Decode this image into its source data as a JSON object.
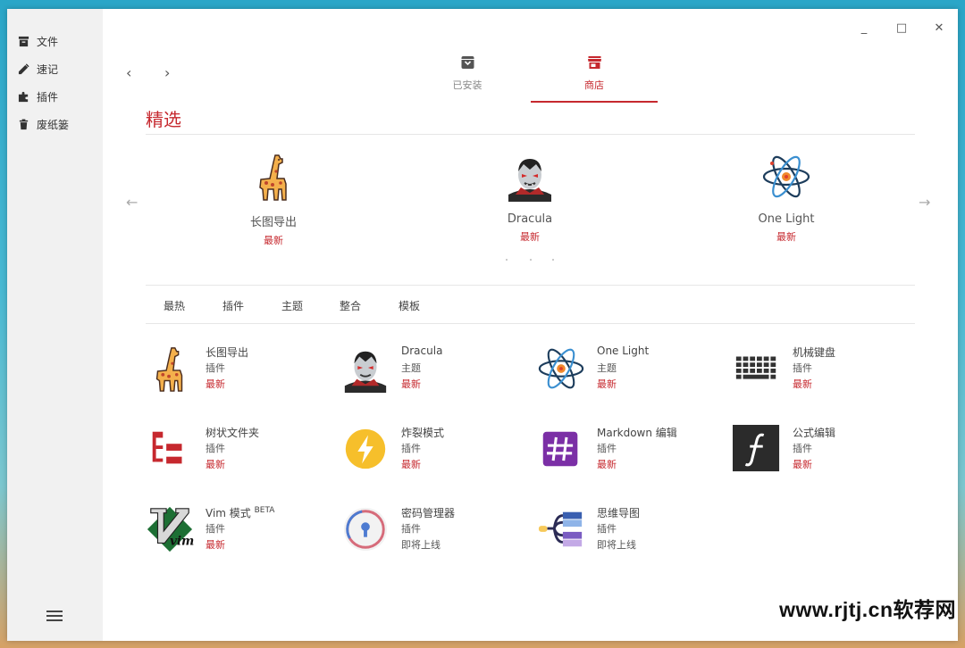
{
  "sidebar": {
    "items": [
      {
        "label": "文件",
        "icon": "archive-icon"
      },
      {
        "label": "速记",
        "icon": "pencil-icon"
      },
      {
        "label": "插件",
        "icon": "puzzle-icon"
      },
      {
        "label": "废纸篓",
        "icon": "trash-icon"
      }
    ],
    "menu_icon": "hamburger-icon"
  },
  "window_controls": {
    "minimize": "_",
    "maximize": "□",
    "close": "✕"
  },
  "nav": {
    "back": "‹",
    "forward": "›"
  },
  "tabs": [
    {
      "label": "已安装",
      "icon": "installed-box-icon",
      "active": false
    },
    {
      "label": "商店",
      "icon": "store-icon",
      "active": true
    }
  ],
  "featured": {
    "title": "精选",
    "prev": "←",
    "next": "→",
    "items": [
      {
        "name": "长图导出",
        "tag": "最新",
        "icon": "giraffe-icon"
      },
      {
        "name": "Dracula",
        "tag": "最新",
        "icon": "dracula-icon"
      },
      {
        "name": "One Light",
        "tag": "最新",
        "icon": "atom-icon"
      }
    ]
  },
  "categories": [
    "最热",
    "插件",
    "主题",
    "整合",
    "模板"
  ],
  "plugins": [
    {
      "name": "长图导出",
      "type": "插件",
      "status": "最新",
      "icon": "giraffe-icon"
    },
    {
      "name": "Dracula",
      "type": "主题",
      "status": "最新",
      "icon": "dracula-icon"
    },
    {
      "name": "One Light",
      "type": "主题",
      "status": "最新",
      "icon": "atom-icon"
    },
    {
      "name": "机械键盘",
      "type": "插件",
      "status": "最新",
      "icon": "keyboard-icon"
    },
    {
      "name": "树状文件夹",
      "type": "插件",
      "status": "最新",
      "icon": "tree-folder-icon"
    },
    {
      "name": "炸裂模式",
      "type": "插件",
      "status": "最新",
      "icon": "lightning-icon"
    },
    {
      "name": "Markdown 编辑",
      "type": "插件",
      "status": "最新",
      "icon": "hash-icon"
    },
    {
      "name": "公式编辑",
      "type": "插件",
      "status": "最新",
      "icon": "formula-icon"
    },
    {
      "name": "Vim 模式",
      "badge": "BETA",
      "type": "插件",
      "status": "最新",
      "icon": "vim-icon"
    },
    {
      "name": "密码管理器",
      "type": "插件",
      "status": "即将上线",
      "icon": "keyhole-icon"
    },
    {
      "name": "思维导图",
      "type": "插件",
      "status": "即将上线",
      "icon": "mindmap-icon"
    }
  ],
  "watermark": "www.rjtj.cn软荐网",
  "colors": {
    "accent": "#c6282e",
    "sidebar_bg": "#f1f1f1"
  }
}
